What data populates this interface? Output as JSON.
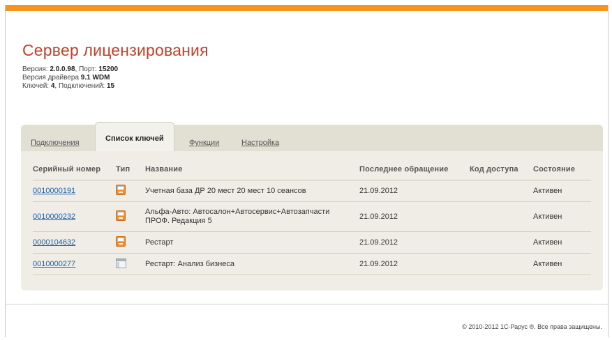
{
  "page": {
    "title": "Сервер лицензирования"
  },
  "meta": {
    "version_label": "Версия: ",
    "version_value": "2.0.0.98",
    "port_label": ", Порт: ",
    "port_value": "15200",
    "driver_label": "Версия драйвера ",
    "driver_value": "9.1 WDM",
    "keys_label": "Ключей: ",
    "keys_value": "4",
    "connections_label": ", Подключений: ",
    "connections_value": "15"
  },
  "tabs": [
    {
      "label": "Подключения",
      "active": false
    },
    {
      "label": "Список ключей",
      "active": true
    },
    {
      "label": "Функции",
      "active": false
    },
    {
      "label": "Настройка",
      "active": false
    }
  ],
  "table": {
    "headers": [
      "Серийный номер",
      "Тип",
      "Название",
      "Последнее обращение",
      "Код доступа",
      "Состояние"
    ],
    "rows": [
      {
        "serial": "0010000191",
        "type_icon": "usb-key-icon",
        "name": "Учетная база ДР 20 мест 20 мест 10 сеансов",
        "last_access": "21.09.2012",
        "access_code": "",
        "status": "Активен"
      },
      {
        "serial": "0010000232",
        "type_icon": "usb-key-icon",
        "name": "Альфа-Авто: Автосалон+Автосервис+Автозапчасти ПРОФ. Редакция 5",
        "last_access": "21.09.2012",
        "access_code": "",
        "status": "Активен"
      },
      {
        "serial": "0000104632",
        "type_icon": "usb-key-icon",
        "name": "Рестарт",
        "last_access": "21.09.2012",
        "access_code": "",
        "status": "Активен"
      },
      {
        "serial": "0010000277",
        "type_icon": "software-key-icon",
        "name": "Рестарт: Анализ бизнеса",
        "last_access": "21.09.2012",
        "access_code": "",
        "status": "Активен"
      }
    ]
  },
  "footer": {
    "copyright": "© 2010-2012 1С-Рарус ®. Все права защищены."
  },
  "colors": {
    "accent_bar": "#f7941d",
    "title": "#c1402a",
    "link": "#1f5ea8",
    "status_active": "#4e9a2c",
    "panel": "#efede6"
  }
}
